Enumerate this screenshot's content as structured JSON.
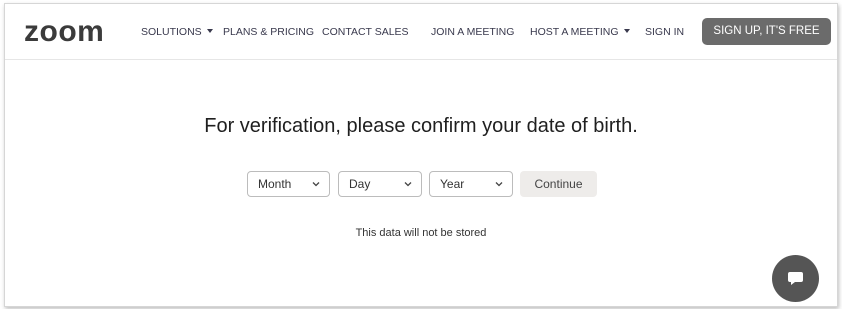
{
  "header": {
    "logo_text": "zoom",
    "nav": {
      "solutions": "SOLUTIONS",
      "plans_pricing": "PLANS & PRICING",
      "contact_sales": "CONTACT SALES",
      "join_meeting": "JOIN A MEETING",
      "host_meeting": "HOST A MEETING",
      "sign_in": "SIGN IN"
    },
    "signup_label": "SIGN UP, IT'S FREE"
  },
  "verification": {
    "title": "For verification, please confirm your date of birth.",
    "month_select": "Month",
    "day_select": "Day",
    "year_select": "Year",
    "continue_label": "Continue",
    "note": "This data will not be stored"
  },
  "icons": {
    "dropdown": "caret-down-icon",
    "select_arrow": "chevron-down-icon",
    "chat": "chat-bubble-icon"
  },
  "colors": {
    "signup_button": "#6b6b6b",
    "continue_button": "#eeecea",
    "chat_button": "#555555"
  }
}
